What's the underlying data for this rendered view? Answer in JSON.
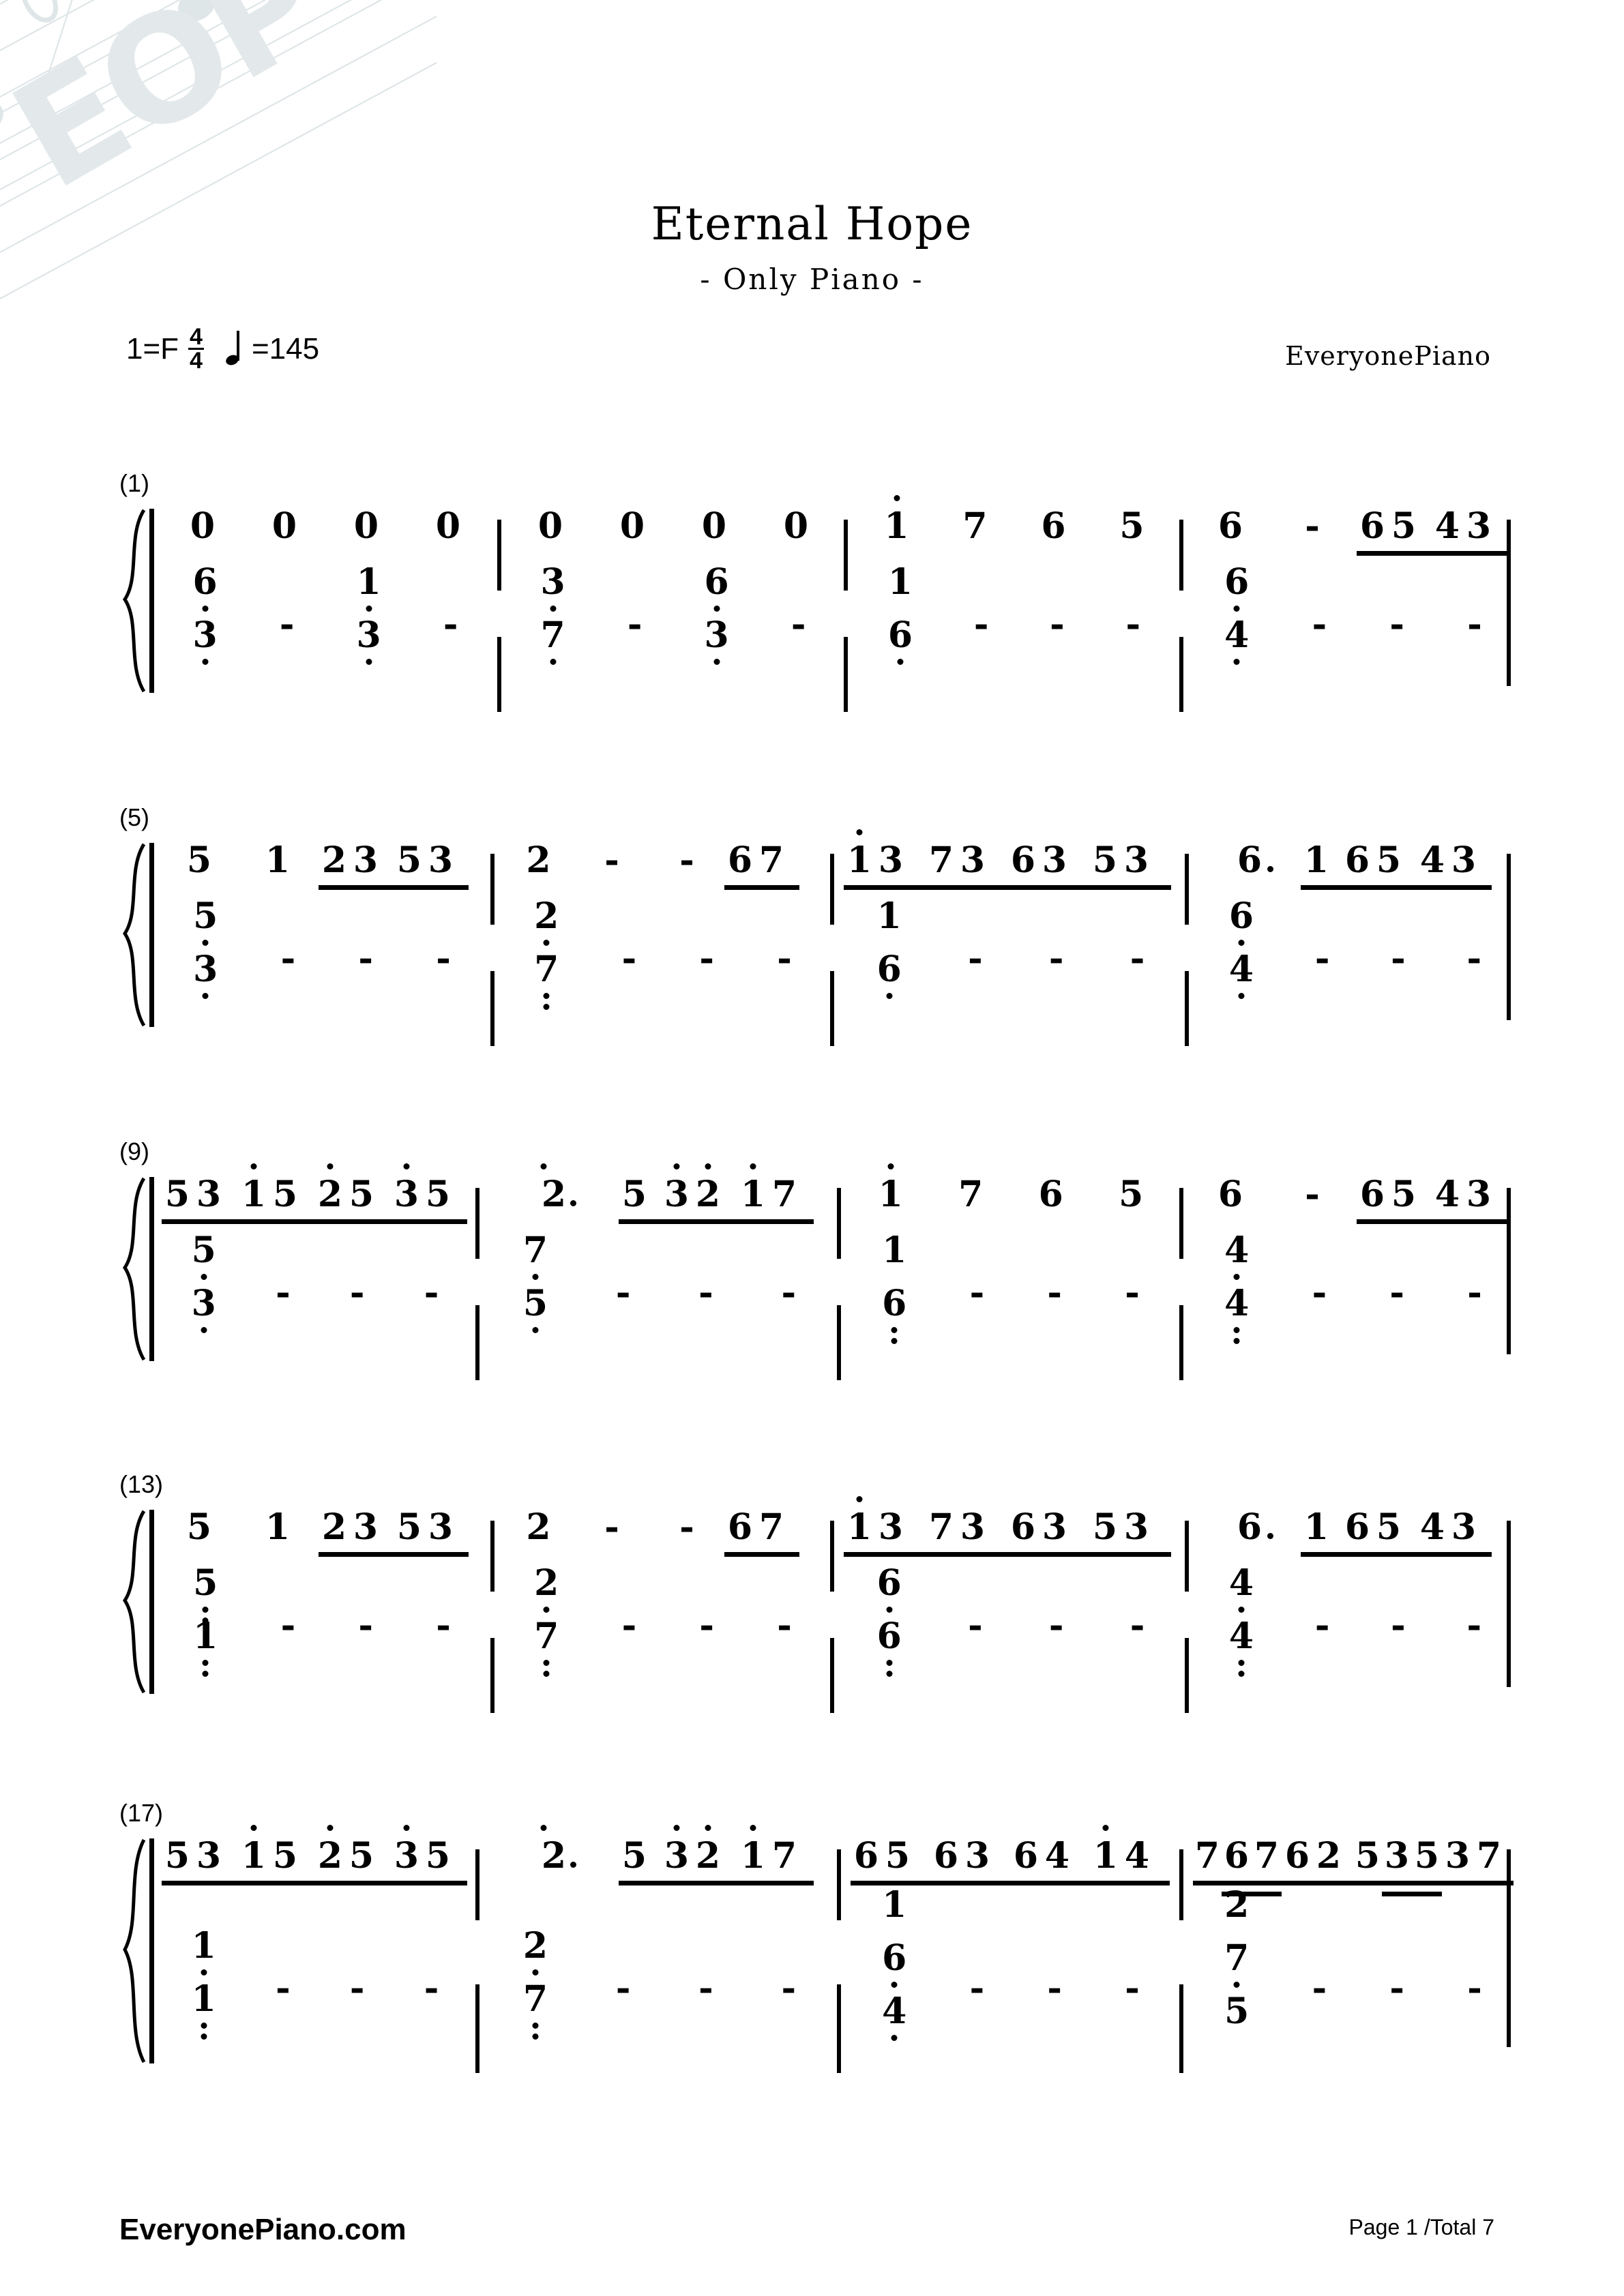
{
  "header": {
    "title": "Eternal Hope",
    "subtitle": "- Only Piano -",
    "key_label": "1=F",
    "time_num": "4",
    "time_den": "4",
    "tempo_equals": "=145",
    "credit": "EveryonePiano"
  },
  "footer": {
    "site": "EveryonePiano.com",
    "page": "Page 1 /Total 7"
  },
  "watermark": {
    "text": "EOP"
  },
  "systems": [
    {
      "label": "(1)",
      "measures": [
        {
          "number": 1,
          "treble": "0 0 0 0",
          "bass": "6(low)/3(low) - 1(low)/3(low) -"
        },
        {
          "number": 2,
          "treble": "0 0 0 0",
          "bass": "3(low)/7(low) - 6(low)/3(low) -"
        },
        {
          "number": 3,
          "treble": "1(high) 7 6 5",
          "bass": "1/6(low) - - -"
        },
        {
          "number": 4,
          "treble": "6 - 6 5 4 3",
          "bass": "6(low)/4(low) - - -"
        }
      ]
    },
    {
      "label": "(5)",
      "measures": [
        {
          "number": 5,
          "treble": "5 1 2 3 5 3",
          "bass": "5(low)/3(low) - - -"
        },
        {
          "number": 6,
          "treble": "2 - - 6 7",
          "bass": "2(low)/7(low) - - -"
        },
        {
          "number": 7,
          "treble": "1(high) 3 7 3 6 3 5 3",
          "bass": "1/6(low) - - -"
        },
        {
          "number": 8,
          "treble": "6. 1 6 5 4 3",
          "bass": "6(low)/4(low) - - -"
        }
      ]
    },
    {
      "label": "(9)",
      "measures": [
        {
          "number": 9,
          "treble": "5 3 1(high) 5 2(high) 5 3(high) 5",
          "bass": "5(low)/3(low) - - -"
        },
        {
          "number": 10,
          "treble": "2(high). 5 3(high) 2(high) 1(high) 7",
          "bass": "7(low)/5(low) - - -"
        },
        {
          "number": 11,
          "treble": "1(high) 7 6 5",
          "bass": "1/6(low) - - -"
        },
        {
          "number": 12,
          "treble": "6 - 6 5 4 3",
          "bass": "4/4(low) - - -"
        }
      ]
    },
    {
      "label": "(13)",
      "measures": [
        {
          "number": 13,
          "treble": "5 1 2 3 5 3",
          "bass": "5(low)/1(low) - - -"
        },
        {
          "number": 14,
          "treble": "2 - - 6 7",
          "bass": "2(low)/7(low) - - -"
        },
        {
          "number": 15,
          "treble": "1(high) 3 7 3 6 3 5 3",
          "bass": "6(low)/6(low) - - -"
        },
        {
          "number": 16,
          "treble": "6. 1 6 5 4 3",
          "bass": "4/4(low) - - -"
        }
      ]
    },
    {
      "label": "(17)",
      "measures": [
        {
          "number": 17,
          "treble": "5 3 1(high) 5 2(high) 5 3(high) 5",
          "bass": "1(low)/1(low) - - -"
        },
        {
          "number": 18,
          "treble": "2(high). 5 3(high) 2(high) 1(high) 7",
          "bass": "2(low)/7(low) - - -"
        },
        {
          "number": 19,
          "treble": "6 5 6 3 6 4 1(high) 4",
          "bass": "1/6/4(low) - - -"
        },
        {
          "number": 20,
          "treble": "7 6 7 6 2 5 3 5 3 7",
          "bass": "2/7/5 - - -"
        }
      ]
    }
  ],
  "notation": {
    "sys1": {
      "treble": {
        "m1": [
          "0",
          "0",
          "0",
          "0"
        ],
        "m2": [
          "0",
          "0",
          "0",
          "0"
        ],
        "m3": [
          "1",
          "7",
          "6",
          "5"
        ],
        "m4": [
          "6",
          "-",
          "6",
          "5",
          "4",
          "3"
        ]
      },
      "bass": {
        "m1": [
          [
            "6",
            "3"
          ],
          [
            "-"
          ],
          [
            "1",
            "3"
          ],
          [
            "-"
          ]
        ],
        "m2": [
          [
            "3",
            "7"
          ],
          [
            "-"
          ],
          [
            "6",
            "3"
          ],
          [
            "-"
          ]
        ],
        "m3": [
          [
            "1",
            "6"
          ],
          [
            "-"
          ],
          [
            "-"
          ],
          [
            "-"
          ]
        ],
        "m4": [
          [
            "6",
            "4"
          ],
          [
            "-"
          ],
          [
            "-"
          ],
          [
            "-"
          ]
        ]
      }
    },
    "sys2": {
      "treble": {
        "m5": [
          "5",
          "1",
          "2",
          "3",
          "5",
          "3"
        ],
        "m6": [
          "2",
          "-",
          "-",
          "6",
          "7"
        ],
        "m7": [
          "1",
          "3",
          "7",
          "3",
          "6",
          "3",
          "5",
          "3"
        ],
        "m8": [
          "6",
          "1",
          "6",
          "5",
          "4",
          "3"
        ]
      },
      "bass": {
        "m5": [
          [
            "5",
            "3"
          ],
          [
            "-"
          ],
          [
            "-"
          ],
          [
            "-"
          ]
        ],
        "m6": [
          [
            "2",
            "7"
          ],
          [
            "-"
          ],
          [
            "-"
          ],
          [
            "-"
          ]
        ],
        "m7": [
          [
            "1",
            "6"
          ],
          [
            "-"
          ],
          [
            "-"
          ],
          [
            "-"
          ]
        ],
        "m8": [
          [
            "6",
            "4"
          ],
          [
            "-"
          ],
          [
            "-"
          ],
          [
            "-"
          ]
        ]
      }
    },
    "sys3": {
      "treble": {
        "m9": [
          "5",
          "3",
          "1",
          "5",
          "2",
          "5",
          "3",
          "5"
        ],
        "m10": [
          "2",
          "5",
          "3",
          "2",
          "1",
          "7"
        ],
        "m11": [
          "1",
          "7",
          "6",
          "5"
        ],
        "m12": [
          "6",
          "-",
          "6",
          "5",
          "4",
          "3"
        ]
      },
      "bass": {
        "m9": [
          [
            "5",
            "3"
          ],
          [
            "-"
          ],
          [
            "-"
          ],
          [
            "-"
          ]
        ],
        "m10": [
          [
            "7",
            "5"
          ],
          [
            "-"
          ],
          [
            "-"
          ],
          [
            "-"
          ]
        ],
        "m11": [
          [
            "1",
            "6"
          ],
          [
            "-"
          ],
          [
            "-"
          ],
          [
            "-"
          ]
        ],
        "m12": [
          [
            "4",
            "4"
          ],
          [
            "-"
          ],
          [
            "-"
          ],
          [
            "-"
          ]
        ]
      }
    },
    "sys4": {
      "treble": {
        "m13": [
          "5",
          "1",
          "2",
          "3",
          "5",
          "3"
        ],
        "m14": [
          "2",
          "-",
          "-",
          "6",
          "7"
        ],
        "m15": [
          "1",
          "3",
          "7",
          "3",
          "6",
          "3",
          "5",
          "3"
        ],
        "m16": [
          "6",
          "1",
          "6",
          "5",
          "4",
          "3"
        ]
      },
      "bass": {
        "m13": [
          [
            "5",
            "1"
          ],
          [
            "-"
          ],
          [
            "-"
          ],
          [
            "-"
          ]
        ],
        "m14": [
          [
            "2",
            "7"
          ],
          [
            "-"
          ],
          [
            "-"
          ],
          [
            "-"
          ]
        ],
        "m15": [
          [
            "6",
            "6"
          ],
          [
            "-"
          ],
          [
            "-"
          ],
          [
            "-"
          ]
        ],
        "m16": [
          [
            "4",
            "4"
          ],
          [
            "-"
          ],
          [
            "-"
          ],
          [
            "-"
          ]
        ]
      }
    },
    "sys5": {
      "treble": {
        "m17": [
          "5",
          "3",
          "1",
          "5",
          "2",
          "5",
          "3",
          "5"
        ],
        "m18": [
          "2",
          "5",
          "3",
          "2",
          "1",
          "7"
        ],
        "m19": [
          "6",
          "5",
          "6",
          "3",
          "6",
          "4",
          "1",
          "4"
        ],
        "m20": [
          "7",
          "6",
          "7",
          "6",
          "2",
          "5",
          "3",
          "5",
          "3",
          "7"
        ]
      },
      "bass": {
        "m17": [
          [
            "1",
            "1"
          ],
          [
            "-"
          ],
          [
            "-"
          ],
          [
            "-"
          ]
        ],
        "m18": [
          [
            "2",
            "7"
          ],
          [
            "-"
          ],
          [
            "-"
          ],
          [
            "-"
          ]
        ],
        "m19": [
          [
            "1",
            "6",
            "4"
          ],
          [
            "-"
          ],
          [
            "-"
          ],
          [
            "-"
          ]
        ],
        "m20": [
          [
            "2",
            "7",
            "5"
          ],
          [
            "-"
          ],
          [
            "-"
          ],
          [
            "-"
          ]
        ]
      }
    }
  }
}
